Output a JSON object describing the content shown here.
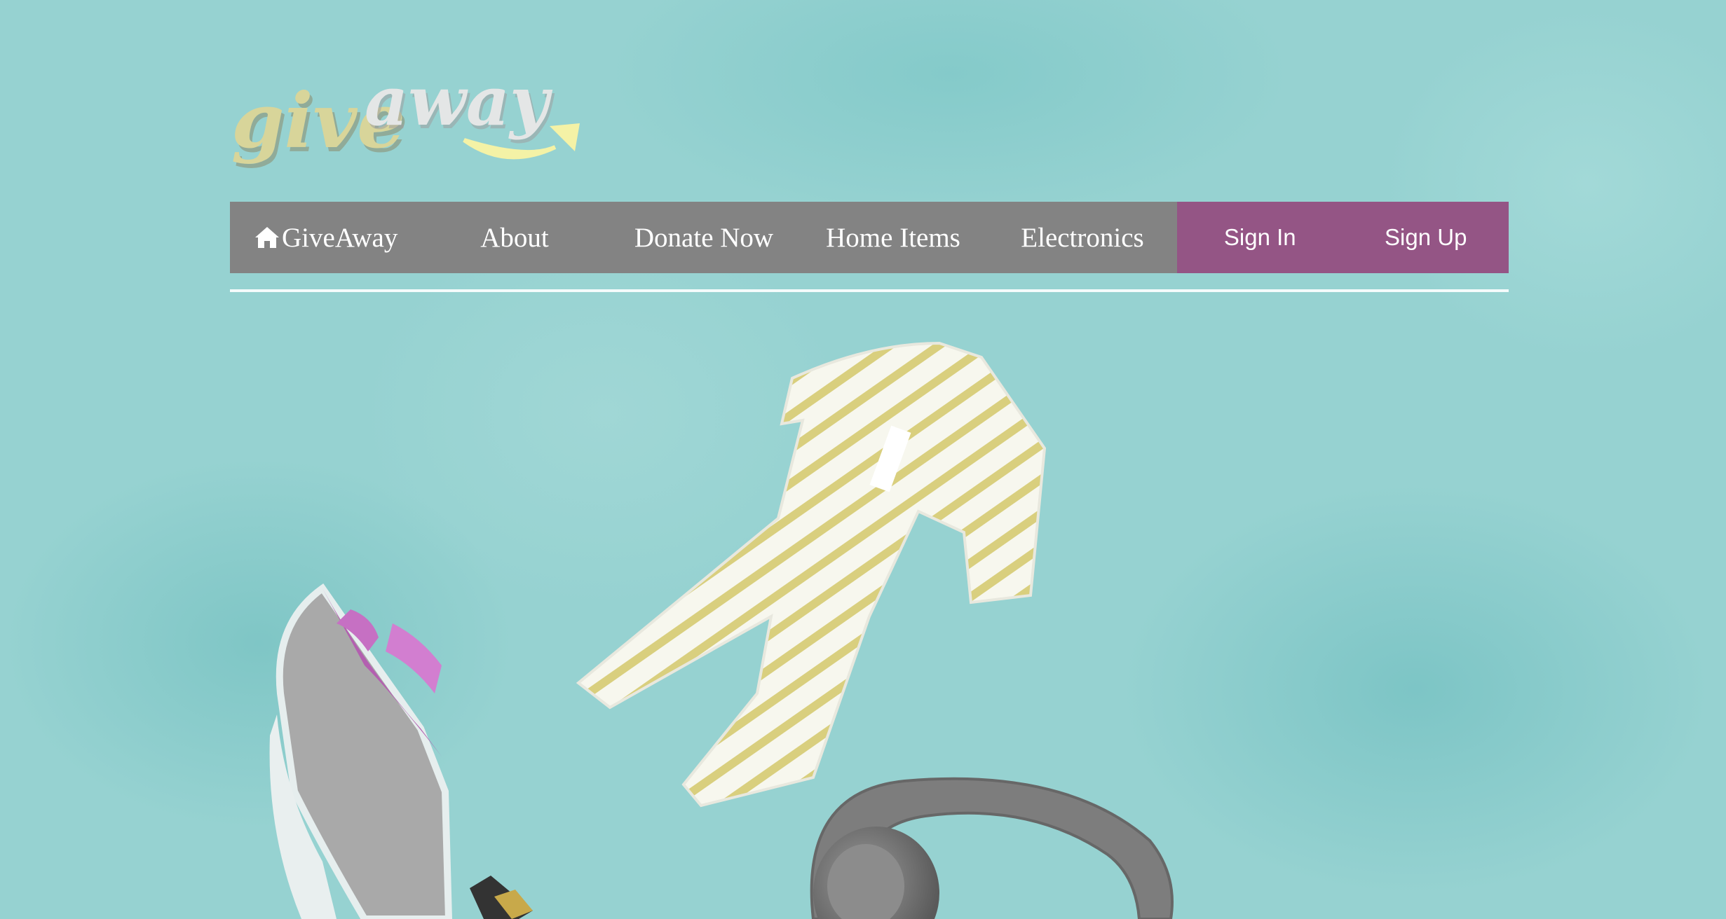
{
  "logo": {
    "text": "giveaway",
    "colors": {
      "give": "#d8d59a",
      "away": "#e4e6e6",
      "smile": "#f4f2a6"
    }
  },
  "nav": {
    "items": [
      {
        "label": "GiveAway",
        "icon": "home-icon"
      },
      {
        "label": "About"
      },
      {
        "label": "Donate Now"
      },
      {
        "label": "Home Items"
      },
      {
        "label": "Electronics"
      }
    ],
    "auth": [
      {
        "label": "Sign In"
      },
      {
        "label": "Sign Up"
      }
    ]
  },
  "colors": {
    "background": "#96d2d1",
    "nav_bg": "#838383",
    "auth_bg": "#945585",
    "nav_text": "#ffffff"
  },
  "hero": {
    "items": [
      "striped-onesie-image",
      "sneaker-image",
      "headphones-image",
      "pencil-image"
    ]
  }
}
